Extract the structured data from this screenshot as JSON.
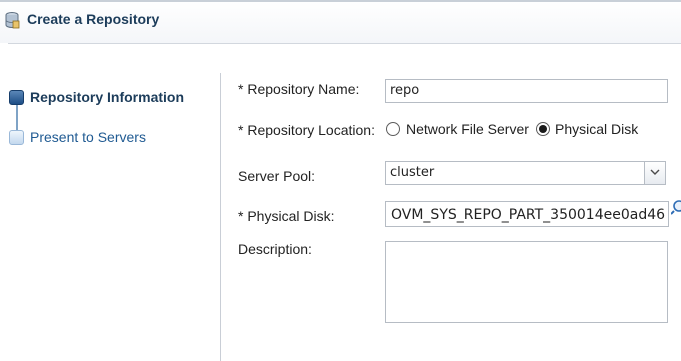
{
  "header": {
    "title": "Create a Repository",
    "icon": "database-icon"
  },
  "train": {
    "steps": [
      {
        "label": "Repository Information",
        "state": "active"
      },
      {
        "label": "Present to Servers",
        "state": "inactive"
      }
    ]
  },
  "form": {
    "required_marker": "*",
    "repository_name": {
      "label": "Repository Name:",
      "value": "repo"
    },
    "repository_location": {
      "label": "Repository Location:",
      "options": [
        {
          "label": "Network File Server",
          "selected": false
        },
        {
          "label": "Physical Disk",
          "selected": true
        }
      ]
    },
    "server_pool": {
      "label": "Server Pool:",
      "value": "cluster"
    },
    "physical_disk": {
      "label": "Physical Disk:",
      "value": "OVM_SYS_REPO_PART_350014ee0ad46"
    },
    "description": {
      "label": "Description:",
      "value": ""
    }
  },
  "colors": {
    "title": "#1c3c5a",
    "accent": "#1d4e86",
    "link": "#1f5a92"
  }
}
